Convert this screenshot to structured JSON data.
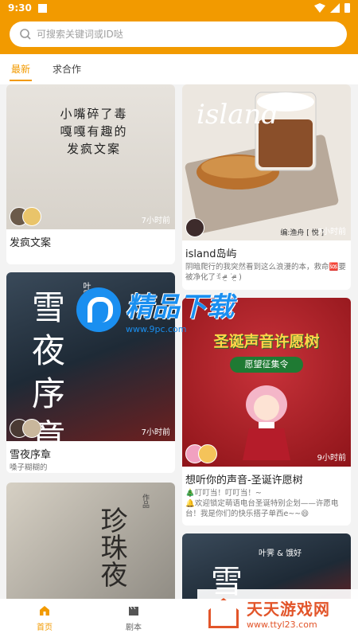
{
  "status": {
    "time": "9:30"
  },
  "search": {
    "placeholder": "可搜索关键词或ID哒"
  },
  "tabs": [
    {
      "label": "最新"
    },
    {
      "label": "求合作"
    }
  ],
  "cards": [
    {
      "cover_text": "小嘴碎了毒\n嘎嘎有趣的\n发疯文案",
      "time": "7小时前",
      "title": "发疯文案",
      "desc": ""
    },
    {
      "cover_text": "island",
      "cover_sub": "编:渔舟 [ 悦 ]",
      "time": "7小时前",
      "title": "island岛屿",
      "desc": "阴暗爬行的我突然看到这么浪漫的本，救命🆘要被净化了ꉂ ᵒ̴̶̷̤ ˙ᵒ̴̶̷̤ ) "
    },
    {
      "cover_text": "雪夜序章",
      "cover_sub": "叶霁",
      "time": "7小时前",
      "title": "雪夜序章",
      "desc": "嗓子糊糊的"
    },
    {
      "cover_text": "圣诞声音许愿树",
      "cover_sub": "愿望征集令",
      "time": "9小时前",
      "title": "想听你的声音-圣诞许愿树",
      "desc": "🎄叮叮当！叮叮当！~\n🔔欢迎锁定萌语电台圣诞特别企划——许愿电台！我是你们的快乐搭子单西e~~😄"
    },
    {
      "cover_text": "珍珠夜",
      "cover_sub": "作品",
      "time": "",
      "title": "",
      "desc": ""
    },
    {
      "cover_text": "雪",
      "cover_sub": "叶霁 & 饿好",
      "time": "",
      "title": "",
      "desc": ""
    }
  ],
  "watermark_top": {
    "title": "精品下载",
    "url": "www.9pc.com"
  },
  "watermark_bottom": {
    "title": "天天游戏网",
    "url": "www.ttyl23.com"
  },
  "nav": [
    {
      "label": "首页",
      "icon": "home-icon"
    },
    {
      "label": "剧本",
      "icon": "clapperboard-icon"
    }
  ]
}
